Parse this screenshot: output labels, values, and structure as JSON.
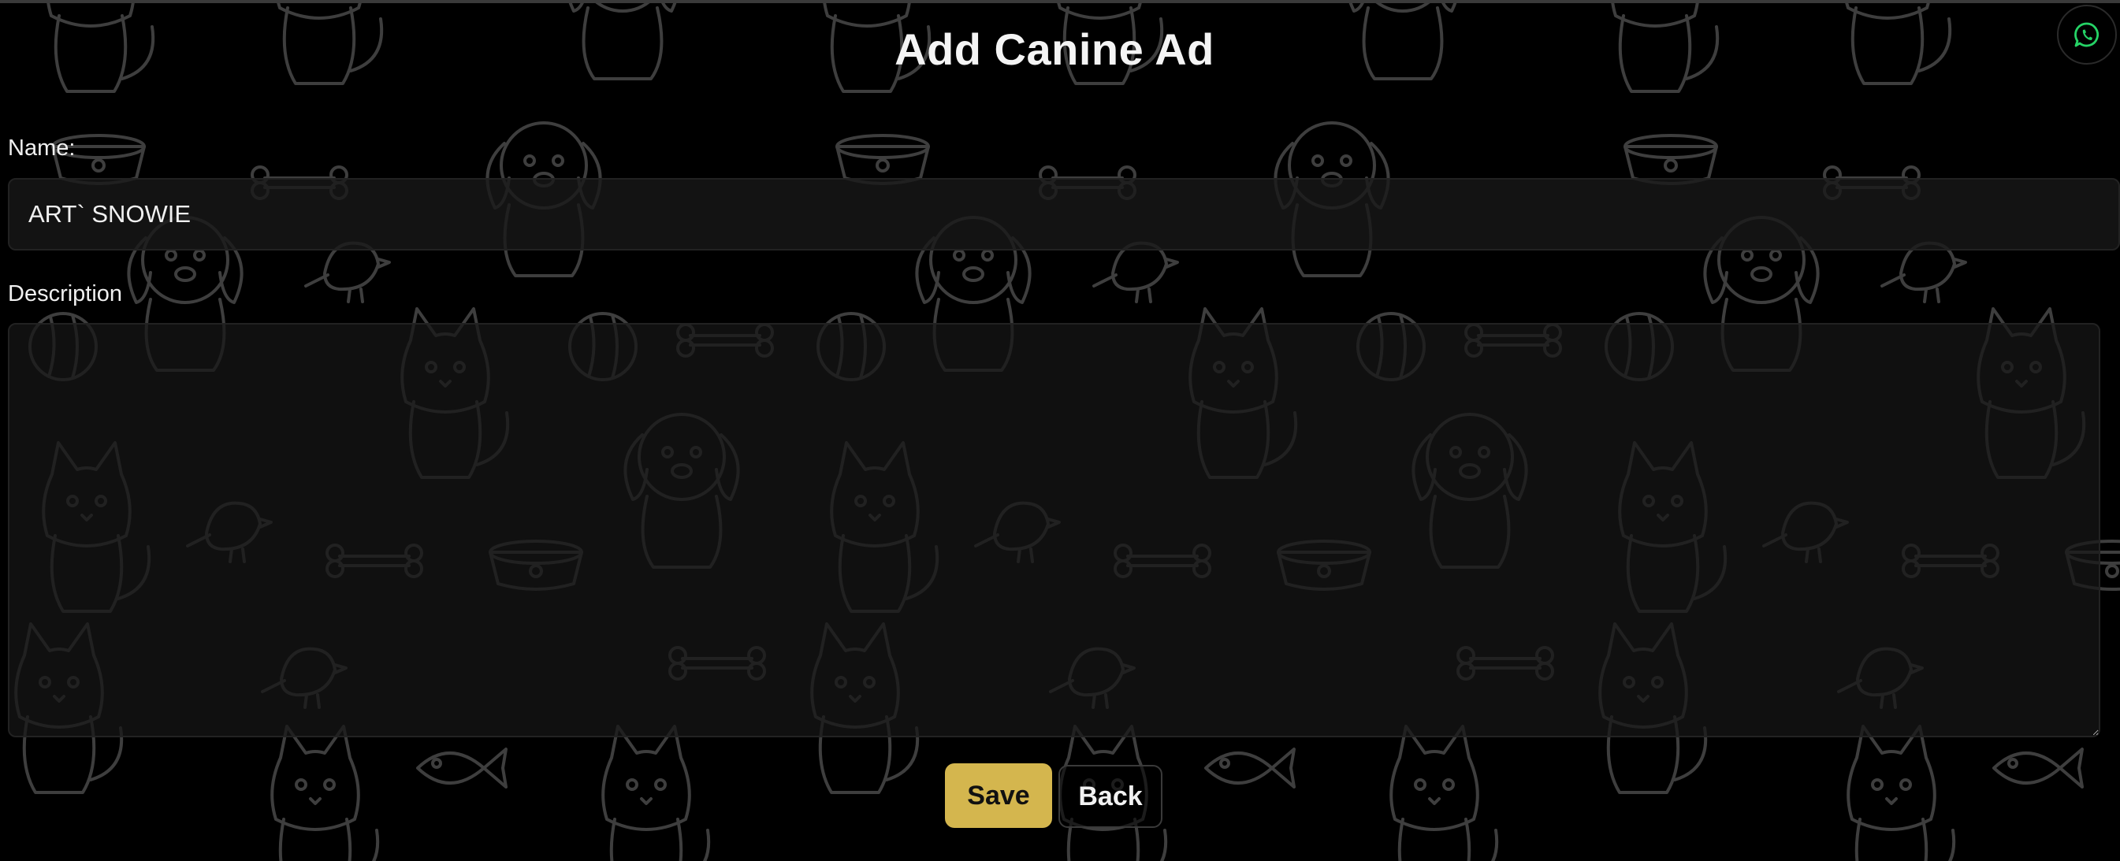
{
  "page": {
    "title": "Add Canine Ad"
  },
  "form": {
    "name_label": "Name:",
    "name_value": "ART` SNOWIE",
    "description_label": "Description",
    "description_value": ""
  },
  "actions": {
    "save_label": "Save",
    "back_label": "Back"
  },
  "floating": {
    "whatsapp_icon": "whatsapp-icon"
  },
  "theme": {
    "background": "#000000",
    "accent": "#d4b64e",
    "whatsapp_green": "#25d366"
  }
}
